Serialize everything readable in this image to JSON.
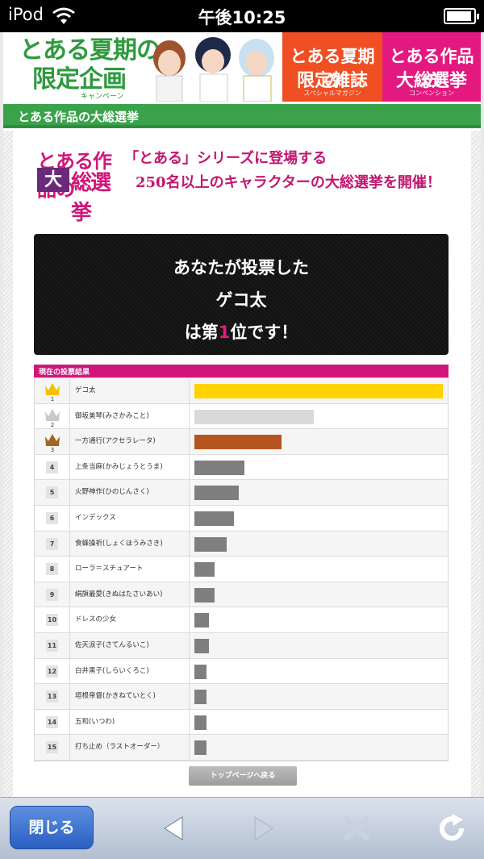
{
  "status_bar": {
    "carrier": "iPod",
    "time": "午後10:25"
  },
  "banners": {
    "main_line1": "とある夏期の",
    "main_line2": "限定企画",
    "main_sub": "キャンペーン",
    "magazine_line1": "とある夏期の",
    "magazine_line2": "限定雑誌",
    "magazine_sub": "スペシャルマガジン",
    "election_line1": "とある作品の",
    "election_line2": "大総選挙",
    "election_sub": "コンベンション"
  },
  "section": {
    "title": "とある作品の大総選挙"
  },
  "intro": {
    "logo_top": "とある作品の",
    "logo_box": "大",
    "logo_rest": "総選挙",
    "headline1": "「とある」シリーズに登場する",
    "headline2": "250名以上のキャラクターの大総選挙を開催！"
  },
  "vote_box": {
    "line1": "あなたが投票した",
    "line2": "ゲコ太",
    "line3_prefix": "は第",
    "line3_rank": "1",
    "line3_suffix": "位です！"
  },
  "results": {
    "header": "現在の投票結果",
    "rows": [
      {
        "rank": "1",
        "name": "ゲコ太",
        "value": 100,
        "color": "#ffd200",
        "crown": "gold"
      },
      {
        "rank": "2",
        "name": "御坂美琴(みさかみこと)",
        "value": 48,
        "color": "#d9d9d9",
        "crown": "silver"
      },
      {
        "rank": "3",
        "name": "一方通行(アクセラレータ)",
        "value": 35,
        "color": "#b5541f",
        "crown": "bronze"
      },
      {
        "rank": "4",
        "name": "上条当麻(かみじょうとうま)",
        "value": 20,
        "color": "#7f7f7f"
      },
      {
        "rank": "5",
        "name": "火野神作(ひのじんさく)",
        "value": 18,
        "color": "#7f7f7f"
      },
      {
        "rank": "6",
        "name": "インデックス",
        "value": 16,
        "color": "#7f7f7f"
      },
      {
        "rank": "7",
        "name": "食蜂操祈(しょくほうみさき)",
        "value": 13,
        "color": "#7f7f7f"
      },
      {
        "rank": "8",
        "name": "ローラ＝スチュアート",
        "value": 8,
        "color": "#7f7f7f"
      },
      {
        "rank": "9",
        "name": "絹旗最愛(きぬはたさいあい)",
        "value": 8,
        "color": "#7f7f7f"
      },
      {
        "rank": "10",
        "name": "ドレスの少女",
        "value": 6,
        "color": "#7f7f7f"
      },
      {
        "rank": "11",
        "name": "佐天涙子(さてんるいこ)",
        "value": 6,
        "color": "#7f7f7f"
      },
      {
        "rank": "12",
        "name": "白井黒子(しらいくろこ)",
        "value": 5,
        "color": "#7f7f7f"
      },
      {
        "rank": "13",
        "name": "垣根帝督(かきねていとく)",
        "value": 5,
        "color": "#7f7f7f"
      },
      {
        "rank": "14",
        "name": "五和(いつわ)",
        "value": 5,
        "color": "#7f7f7f"
      },
      {
        "rank": "15",
        "name": "打ち止め（ラストオーダー）",
        "value": 5,
        "color": "#7f7f7f"
      }
    ]
  },
  "top_button": "トップページへ戻る",
  "toolbar": {
    "close_label": "閉じる",
    "icons": [
      "back-icon",
      "forward-icon",
      "stop-icon",
      "reload-icon"
    ]
  },
  "colors": {
    "section_green": "#3aa24a",
    "accent_pink": "#d0167a",
    "magazine_orange": "#f04e23",
    "election_pink": "#e3197f"
  }
}
